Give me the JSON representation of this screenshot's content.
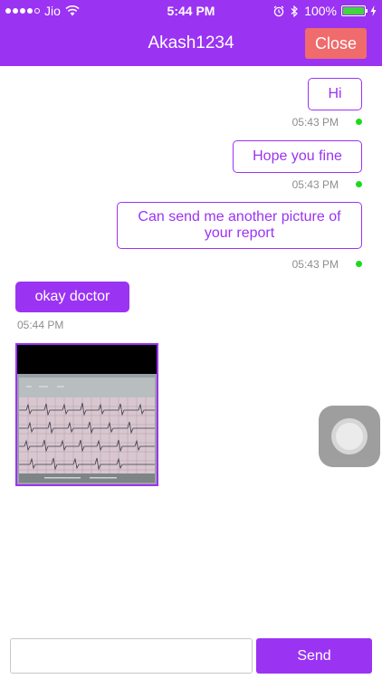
{
  "status_bar": {
    "carrier": "Jio",
    "time": "5:44 PM",
    "battery": "100%",
    "signal_icon": "signal-dots-icon",
    "wifi_icon": "wifi-icon",
    "alarm_icon": "alarm-icon",
    "bluetooth_icon": "bluetooth-icon",
    "battery_icon": "battery-icon",
    "battery_level": 1.0
  },
  "header": {
    "title": "Akash1234",
    "close_label": "Close",
    "color": "#9b33f3",
    "close_color": "#f06b6b"
  },
  "messages": [
    {
      "direction": "outgoing",
      "text": "Hi",
      "time": "05:43 PM"
    },
    {
      "direction": "outgoing",
      "text": "Hope you fine",
      "time": "05:43 PM"
    },
    {
      "direction": "outgoing",
      "text": "Can send me another picture of your report",
      "time": "05:43 PM"
    },
    {
      "direction": "incoming",
      "text": "okay doctor",
      "time": "05:44 PM"
    },
    {
      "direction": "incoming",
      "type": "image",
      "icon": "ecg-report-photo"
    }
  ],
  "input": {
    "placeholder": "",
    "value": ""
  },
  "send_label": "Send",
  "accent_color": "#9b33f3",
  "sent_indicator_color": "#1ed81e"
}
